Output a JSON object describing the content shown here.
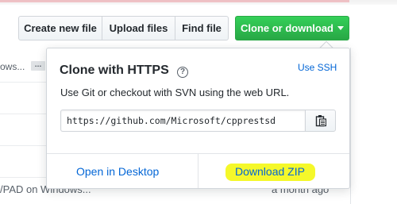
{
  "toolbar": {
    "create_new_file": "Create new file",
    "upload_files": "Upload files",
    "find_file": "Find file",
    "clone_or_download": "Clone or download"
  },
  "background": {
    "row_text_fragment": "ows...",
    "ellipsis_badge": "…",
    "bottom_commit_fragment": "/PAD on Windows...",
    "bottom_age": "a month ago"
  },
  "clone_popover": {
    "title": "Clone with HTTPS",
    "help_glyph": "?",
    "use_ssh": "Use SSH",
    "description": "Use Git or checkout with SVN using the web URL.",
    "url": "https://github.com/Microsoft/cpprestsd",
    "open_in_desktop": "Open in Desktop",
    "download_zip": "Download ZIP"
  },
  "colors": {
    "primary_green": "#28a745",
    "link_blue": "#0366d6",
    "highlight_yellow": "#f5f82a"
  },
  "icons": {
    "help": "question-circle-icon",
    "copy": "clipboard-icon",
    "caret": "caret-down-icon"
  }
}
